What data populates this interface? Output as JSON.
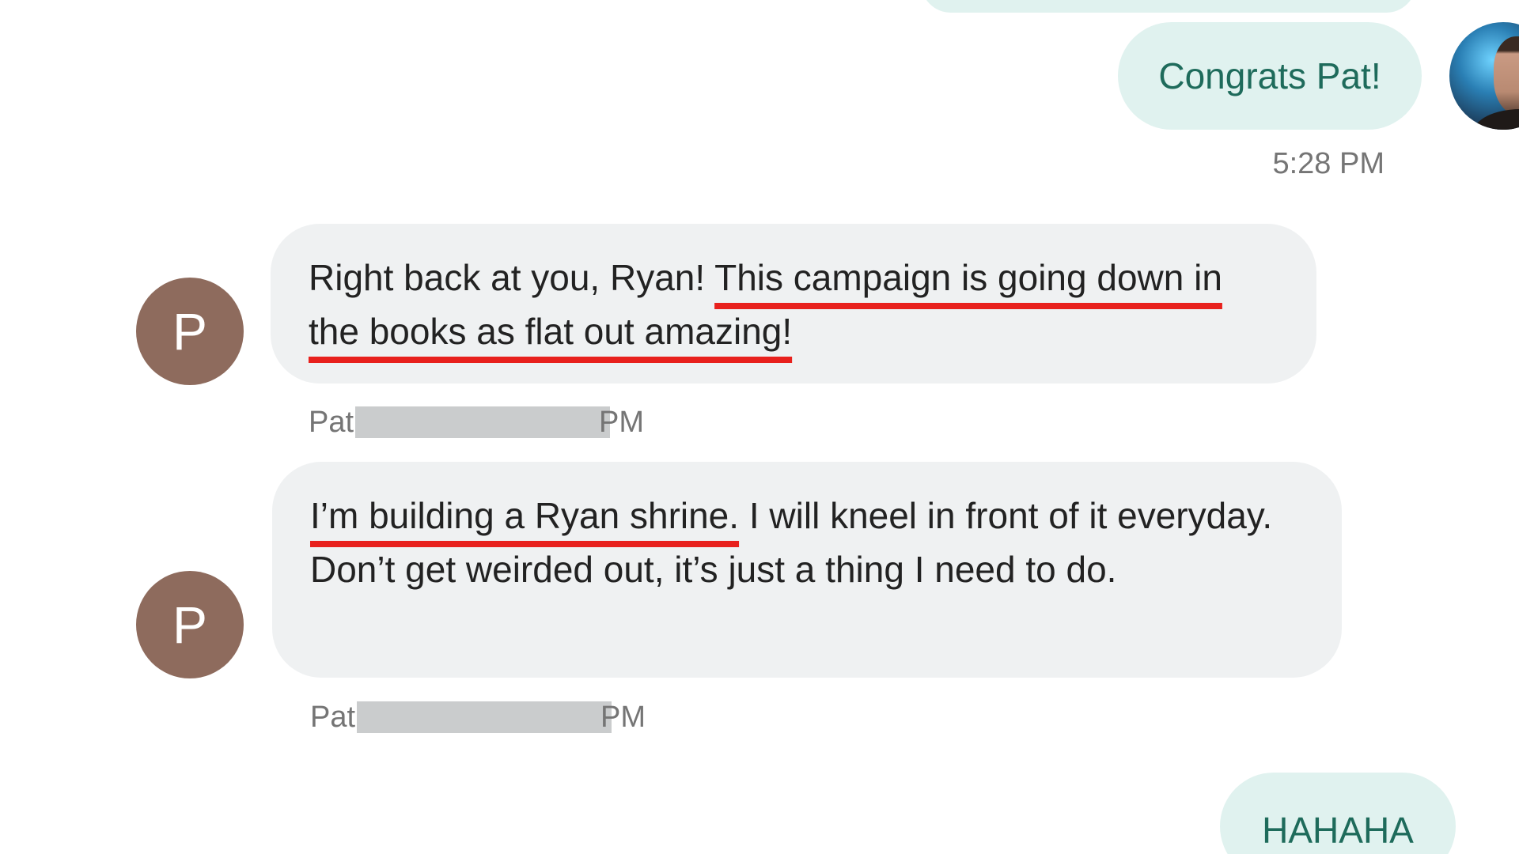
{
  "conversation": {
    "top_outgoing": {
      "text": "Congrats Pat!"
    },
    "top_timestamp": "5:28 PM",
    "messages": [
      {
        "avatar_letter": "P",
        "segments": [
          {
            "text": "Right back at you, Ryan! ",
            "underlined": false
          },
          {
            "text": "This campaign is going down in the books as flat out amazing!",
            "underlined": true
          }
        ],
        "sender": "Pat",
        "time_suffix": "PM"
      },
      {
        "avatar_letter": "P",
        "segments": [
          {
            "text": "I’m building a Ryan shrine.",
            "underlined": true
          },
          {
            "text": " I will kneel in front of it everyday. Don’t get weirded out, it’s just a thing I need to do.",
            "underlined": false
          }
        ],
        "sender": "Pat",
        "time_suffix": "PM"
      }
    ],
    "bottom_outgoing": {
      "text": "HAHAHA"
    }
  },
  "colors": {
    "outgoing_bubble": "#e0f2ef",
    "outgoing_text": "#1e6b5b",
    "incoming_bubble": "#eff1f2",
    "avatar_bg": "#8e6b5d",
    "underline": "#e8211d",
    "redaction": "#cacccd"
  },
  "icons": {
    "sender_avatar": "letter-avatar",
    "self_avatar": "profile-photo"
  }
}
